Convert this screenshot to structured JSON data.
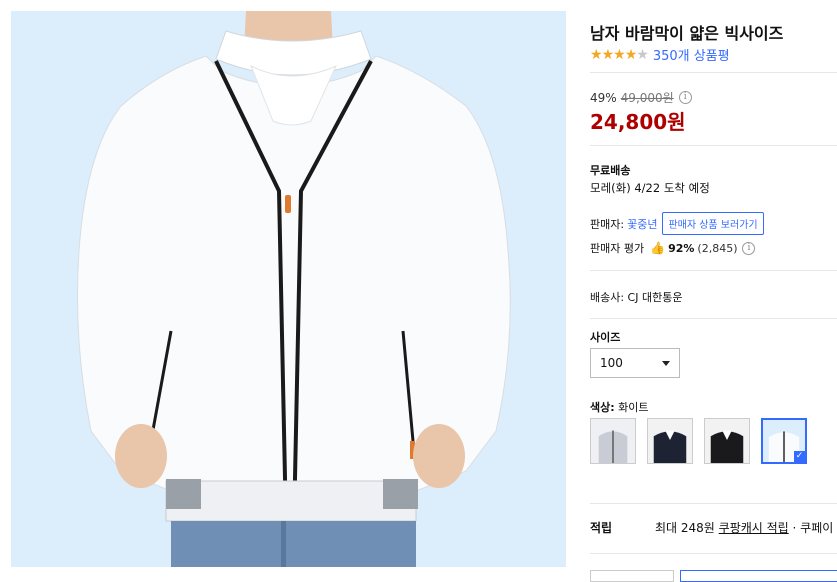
{
  "product": {
    "title": "남자 바람막이 얇은 빅사이즈",
    "rating": 4,
    "rating_max": 5,
    "review_count": "350개 상품평"
  },
  "price": {
    "discount": "49%",
    "original": "49,000원",
    "sale": "24,800원"
  },
  "shipping": {
    "title": "무료배송",
    "arrival": "모레(화) 4/22 도착 예정",
    "carrier": "배송사: CJ 대한통운"
  },
  "seller": {
    "label": "판매자:",
    "name": "꽃중년",
    "button": "판매자 상품 보러가기",
    "rating_label": "판매자 평가",
    "rating_pct": "92%",
    "rating_count": "(2,845)"
  },
  "options": {
    "size_title": "사이즈",
    "size_value": "100",
    "color_label": "색상:",
    "color_value": "화이트",
    "swatches": [
      {
        "name": "light-gray",
        "color": "#d0d2d8"
      },
      {
        "name": "navy",
        "color": "#1d2333"
      },
      {
        "name": "black",
        "color": "#1a1a1c"
      },
      {
        "name": "white",
        "color": "#f4f6f8",
        "selected": true
      }
    ]
  },
  "points": {
    "label": "적립",
    "text": "최대 248원 ",
    "link": "쿠팡캐시 적립",
    "suffix": " · 쿠페이"
  },
  "colors": {
    "accent": "#346aff",
    "price": "#ae0000",
    "star": "#f5a623",
    "photo_bg": "#dceefb"
  }
}
